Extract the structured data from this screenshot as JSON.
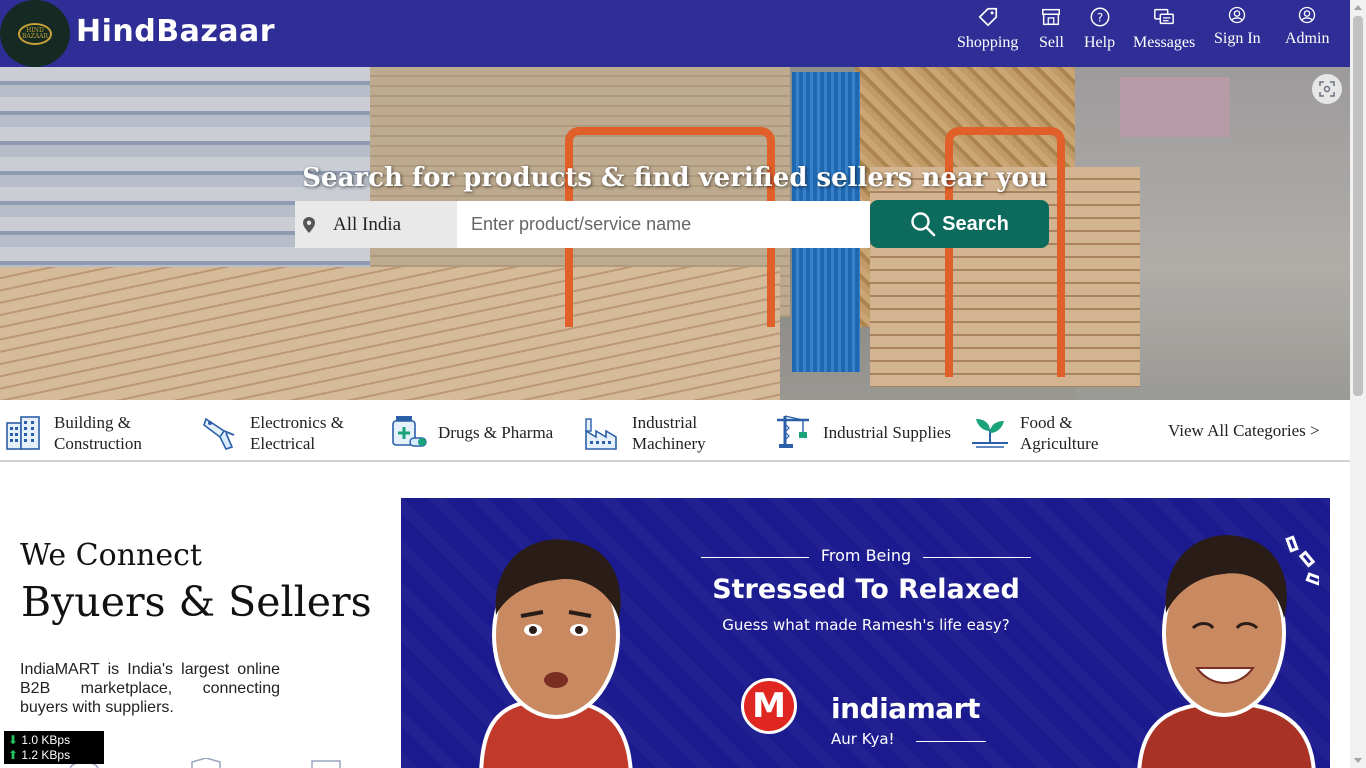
{
  "header": {
    "brand": "HindBazaar",
    "logo_text": "HIND BAZAAR",
    "nav": [
      {
        "label": "Shopping",
        "icon": "tag-icon"
      },
      {
        "label": "Sell",
        "icon": "store-icon"
      },
      {
        "label": "Help",
        "icon": "help-icon"
      },
      {
        "label": "Messages",
        "icon": "messages-icon"
      },
      {
        "label": "Sign In",
        "icon": "user-icon"
      },
      {
        "label": "Admin",
        "icon": "admin-user-icon"
      }
    ],
    "background_color": "#2e2e96"
  },
  "hero": {
    "title": "Search for products & find verified sellers near you",
    "location": "All India",
    "search_placeholder": "Enter product/service name",
    "search_button": "Search",
    "button_color": "#0c6b5c"
  },
  "categories": [
    {
      "line1": "Building &",
      "line2": "Construction",
      "icon": "building-icon"
    },
    {
      "line1": "Electronics &",
      "line2": "Electrical",
      "icon": "drill-icon"
    },
    {
      "line1": "Drugs & Pharma",
      "line2": "",
      "icon": "medicine-icon"
    },
    {
      "line1": "Industrial",
      "line2": "Machinery",
      "icon": "factory-icon"
    },
    {
      "line1": "Industrial Supplies",
      "line2": "",
      "icon": "crane-icon"
    },
    {
      "line1": "Food &",
      "line2": "Agriculture",
      "icon": "plant-icon"
    }
  ],
  "view_all": "View All Categories >",
  "intro": {
    "line1": "We Connect",
    "line2": "Byuers & Sellers",
    "description": "IndiaMART is India's largest online B2B marketplace, connecting buyers with suppliers."
  },
  "banner": {
    "from_being": "From Being",
    "headline": "Stressed To Relaxed",
    "subline": "Guess what made Ramesh's life easy?",
    "brand": "indiamart",
    "tagline": "Aur Kya!",
    "background_color": "#1b1a8e"
  },
  "net_speed": {
    "down": "1.0 KBps",
    "up": "1.2 KBps"
  }
}
